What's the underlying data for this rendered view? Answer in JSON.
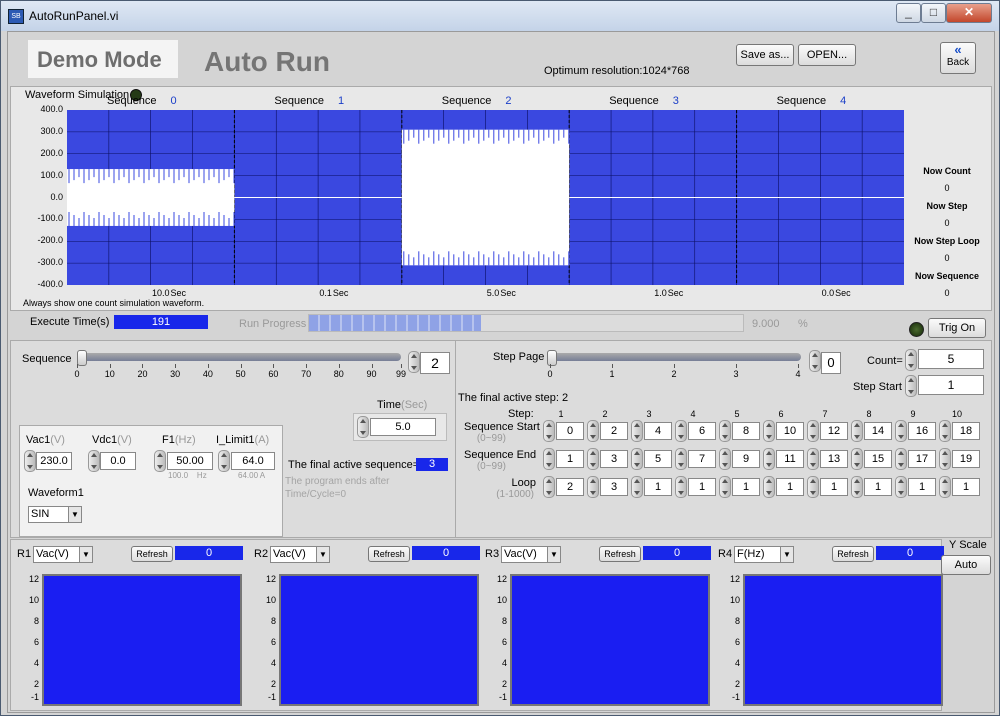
{
  "window": {
    "title": "AutoRunPanel.vi",
    "icon_text": "SB"
  },
  "header": {
    "demo_mode": "Demo Mode",
    "auto_run": "Auto Run",
    "save_as": "Save as...",
    "open": "OPEN...",
    "optimum": "Optimum resolution:1024*768",
    "back": "Back"
  },
  "waveform": {
    "title": "Waveform Simulation",
    "sequence_label": "Sequence",
    "sequences": [
      "0",
      "1",
      "2",
      "3",
      "4"
    ],
    "y_ticks": [
      "400.0",
      "300.0",
      "200.0",
      "100.0",
      "0.0",
      "-100.0",
      "-200.0",
      "-300.0",
      "-400.0"
    ],
    "times": [
      "10.0",
      "0.1",
      "5.0",
      "1.0",
      "0.0"
    ],
    "time_unit": "Sec",
    "note": "Always show one count simulation waveform.",
    "status": [
      {
        "label": "Now Count",
        "value": "0"
      },
      {
        "label": "Now Step",
        "value": "0"
      },
      {
        "label": "Now Step Loop",
        "value": "0"
      },
      {
        "label": "Now Sequence",
        "value": "0"
      }
    ]
  },
  "exec": {
    "label": "Execute Time(s)",
    "value": "191",
    "run_progress": "Run Progress",
    "progress_value": "9.000",
    "progress_unit": "%",
    "progress_fraction": 0.09,
    "trig_on": "Trig On"
  },
  "sequence_slider": {
    "label": "Sequence",
    "ticks": [
      "0",
      "10",
      "20",
      "30",
      "40",
      "50",
      "60",
      "70",
      "80",
      "90",
      "99"
    ],
    "value": "2"
  },
  "params": {
    "vac1": {
      "label": "Vac1",
      "unit": "(V)",
      "value": "230.0"
    },
    "vdc1": {
      "label": "Vdc1",
      "unit": "(V)",
      "value": "0.0"
    },
    "f1": {
      "label": "F1",
      "unit": "(Hz)",
      "value": "50.00",
      "sub": "100.0",
      "sub_unit": "Hz"
    },
    "ilimit": {
      "label": "I_Limit1",
      "unit": "(A)",
      "value": "64.0",
      "sub": "64.00 A"
    },
    "waveform_label": "Waveform1",
    "waveform_value": "SIN",
    "time_label": "Time",
    "time_unit": "(Sec)",
    "time_value": "5.0",
    "final_active_label": "The final active sequence=",
    "final_active_value": "3",
    "ends_note_1": "The program ends after",
    "ends_note_2": "Time/Cycle=0"
  },
  "step": {
    "page_label": "Step Page",
    "page_ticks": [
      "0",
      "1",
      "2",
      "3",
      "4"
    ],
    "page_value": "0",
    "count_label": "Count=",
    "count_value": "5",
    "step_start_label": "Step Start",
    "step_start_value": "1",
    "final_step_label": "The final active step:",
    "final_step_value": "2",
    "step_row_label": "Step:",
    "step_numbers": [
      "1",
      "2",
      "3",
      "4",
      "5",
      "6",
      "7",
      "8",
      "9",
      "10"
    ],
    "seq_start_label": "Sequence Start",
    "seq_start_range": "(0~99)",
    "seq_start": [
      "0",
      "2",
      "4",
      "6",
      "8",
      "10",
      "12",
      "14",
      "16",
      "18"
    ],
    "seq_end_label": "Sequence End",
    "seq_end_range": "(0~99)",
    "seq_end": [
      "1",
      "3",
      "5",
      "7",
      "9",
      "11",
      "13",
      "15",
      "17",
      "19"
    ],
    "loop_label": "Loop",
    "loop_range": "(1-1000)",
    "loop": [
      "2",
      "3",
      "1",
      "1",
      "1",
      "1",
      "1",
      "1",
      "1",
      "1"
    ]
  },
  "readouts": [
    {
      "label": "R1",
      "select": "Vac(V)",
      "refresh": "Refresh",
      "value": "0",
      "ticks": [
        "12",
        "10",
        "8",
        "6",
        "4",
        "2",
        "-1"
      ]
    },
    {
      "label": "R2",
      "select": "Vac(V)",
      "refresh": "Refresh",
      "value": "0",
      "ticks": [
        "12",
        "10",
        "8",
        "6",
        "4",
        "2",
        "-1"
      ]
    },
    {
      "label": "R3",
      "select": "Vac(V)",
      "refresh": "Refresh",
      "value": "0",
      "ticks": [
        "12",
        "10",
        "8",
        "6",
        "4",
        "2",
        "-1"
      ]
    },
    {
      "label": "R4",
      "select": "F(Hz)",
      "refresh": "Refresh",
      "value": "0",
      "ticks": [
        "12",
        "10",
        "8",
        "6",
        "4",
        "2",
        "-1"
      ]
    }
  ],
  "yscale": {
    "label": "Y Scale",
    "auto": "Auto"
  }
}
